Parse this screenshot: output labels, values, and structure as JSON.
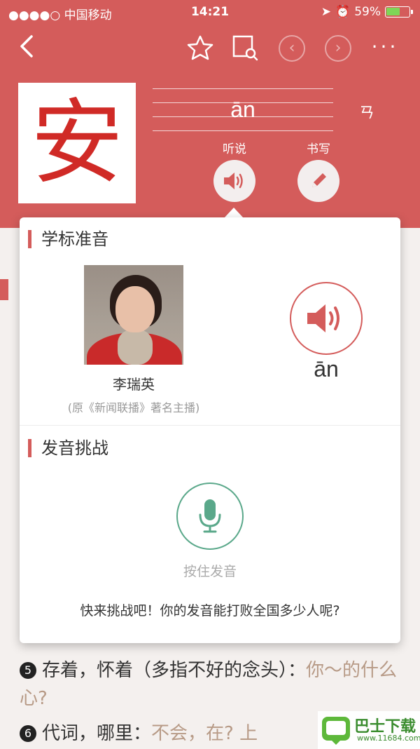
{
  "status_bar": {
    "carrier": "●●●●○ 中国移动",
    "time": "14:21",
    "battery": "59%"
  },
  "nav": {
    "more": "···"
  },
  "character": {
    "glyph": "安",
    "pinyin": "ān",
    "zhuyin": "ㄢ"
  },
  "actions": {
    "listen_label": "听说",
    "write_label": "书写"
  },
  "popup": {
    "standard_title": "学标准音",
    "person_name": "李瑞英",
    "person_desc": "(原《新闻联播》著名主播)",
    "pinyin": "ān",
    "challenge_title": "发音挑战",
    "hold_label": "按住发音",
    "challenge_text": "快来挑战吧！你的发音能打败全国多少人呢?"
  },
  "definitions": [
    {
      "num": "5",
      "text": "存着，怀着（多指不好的念头）：",
      "example": "你～的什么心?"
    },
    {
      "num": "6",
      "text": "代词，哪里：",
      "example": "不会，在?  上"
    }
  ],
  "watermark": {
    "title": "巴士下载",
    "url": "www.11684.com"
  },
  "colors": {
    "brand": "#d45c5b",
    "character": "#d02a26",
    "mic": "#5aa88a"
  },
  "icons": [
    "back-icon",
    "star-icon",
    "search-book-icon",
    "prev-icon",
    "next-icon",
    "more-icon",
    "speaker-icon",
    "pencil-icon",
    "mic-icon"
  ]
}
